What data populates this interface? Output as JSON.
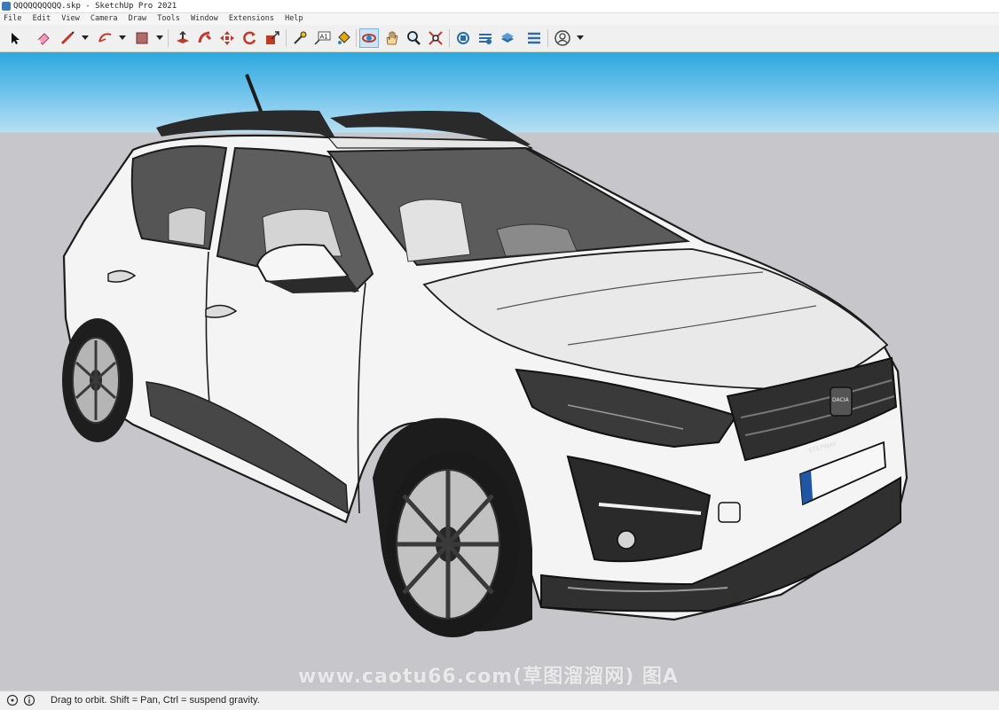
{
  "window": {
    "title": "QQQQQQQQQQ.skp - SketchUp Pro 2021"
  },
  "menu": [
    "File",
    "Edit",
    "View",
    "Camera",
    "Draw",
    "Tools",
    "Window",
    "Extensions",
    "Help"
  ],
  "toolbar": {
    "tools": [
      "select-tool-icon",
      "eraser-tool-icon",
      "line-tool-icon",
      "arc-tool-icon",
      "rectangle-tool-icon",
      "push-pull-tool-icon",
      "follow-me-tool-icon",
      "move-tool-icon",
      "rotate-tool-icon",
      "scale-tool-icon",
      "tape-measure-tool-icon",
      "text-tool-icon",
      "paint-bucket-tool-icon",
      "orbit-tool-icon",
      "pan-tool-icon",
      "zoom-tool-icon",
      "zoom-extents-tool-icon",
      "warehouse-icon",
      "extension-warehouse-icon",
      "layout-icon",
      "extension-manager-icon",
      "account-icon"
    ],
    "active_tool": "orbit-tool-icon",
    "text_tool_label": "A1"
  },
  "viewport": {
    "model": "white compact crossover SUV (Dacia Sandero Stepway) with roof rails and antenna",
    "brand_badge": "DACIA",
    "grille_badge": "STEPWAY",
    "watermark": "www.caotu66.com(草图溜溜网) 图A"
  },
  "status": {
    "message": "Drag to orbit. Shift = Pan, Ctrl = suspend gravity."
  },
  "colors": {
    "sky_top": "#2aa7df",
    "sky_bottom": "#b6dff3",
    "ground": "#c7c7cb",
    "toolbar": "#f0f0f0",
    "accent": "#3a7bbf"
  }
}
